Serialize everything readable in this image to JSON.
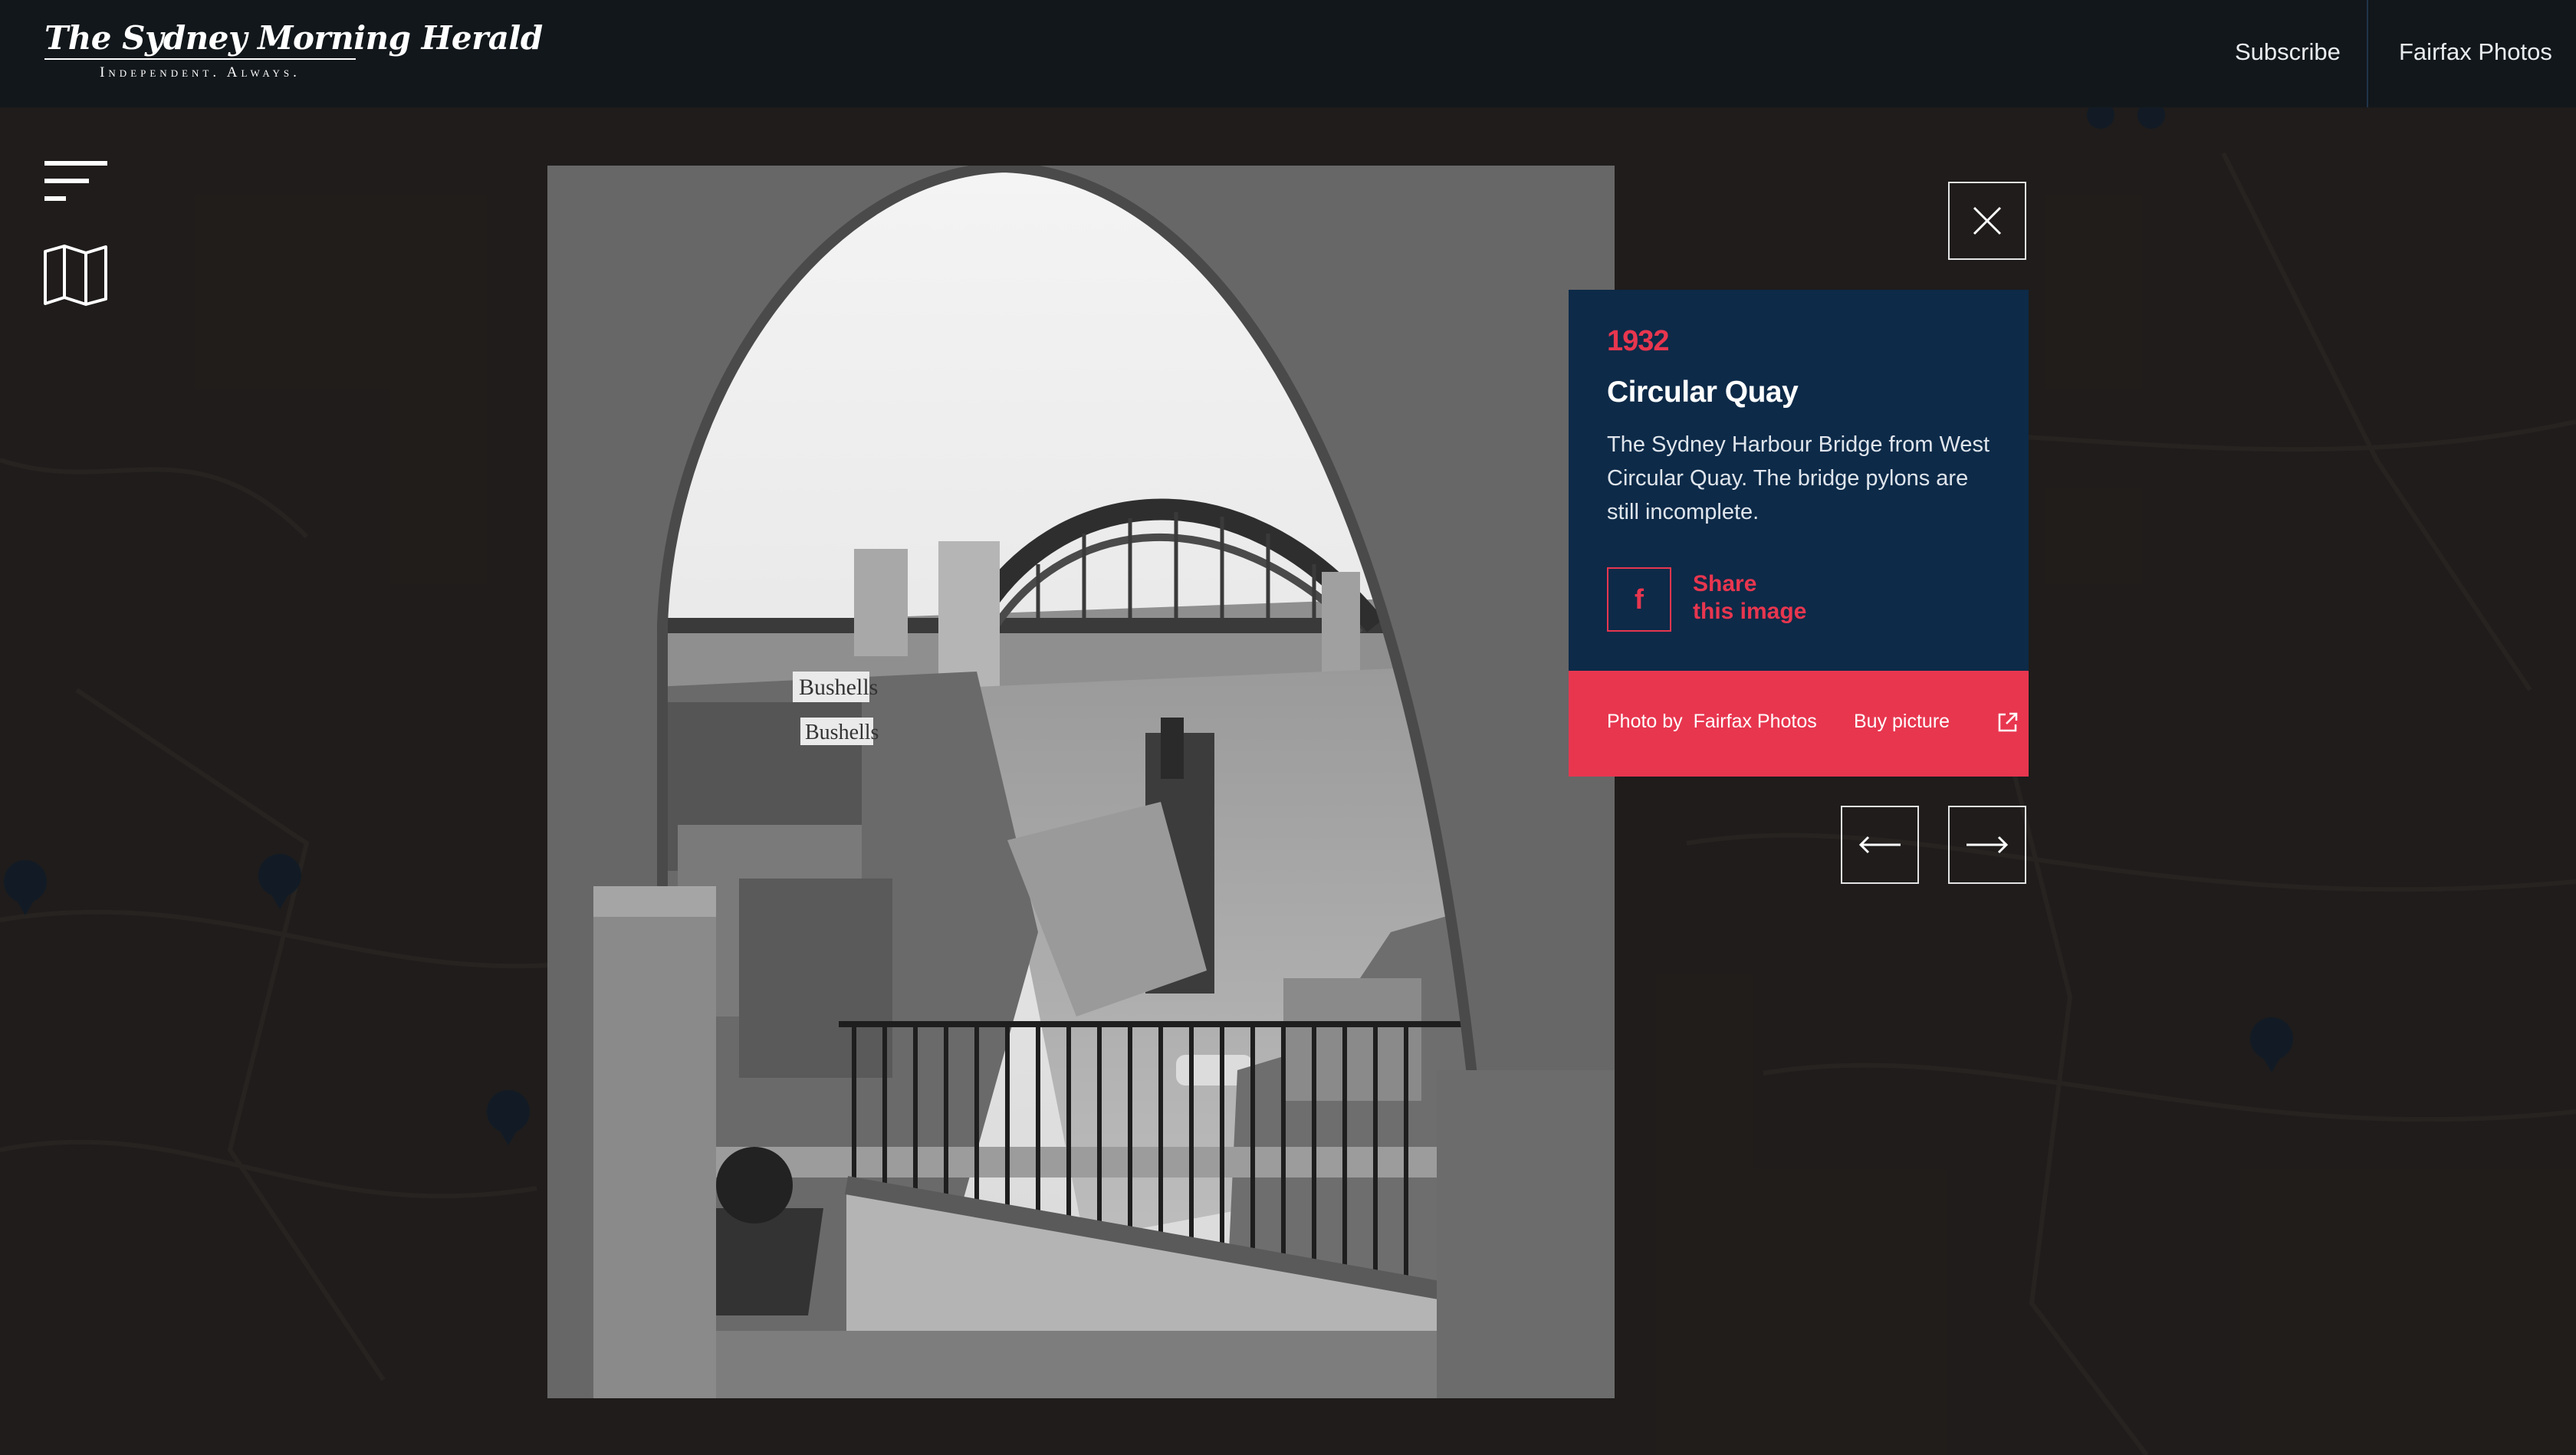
{
  "header": {
    "logo_title": "The Sydney Morning Herald",
    "logo_tagline": "Independent. Always.",
    "links": [
      "Subscribe",
      "Fairfax Photos"
    ]
  },
  "tools": {
    "menu_icon": "hamburger-menu-icon",
    "map_icon": "folded-map-icon"
  },
  "photo": {
    "description": "Black and white photograph of the Sydney Harbour Bridge viewed through a stone arch, with Bushells signs and wharves in the foreground",
    "signs": [
      "Bushells",
      "Bushells"
    ]
  },
  "close_icon": "close-x-icon",
  "card": {
    "year": "1932",
    "title": "Circular Quay",
    "description": "The Sydney Harbour Bridge from West Circular Quay. The bridge pylons are still incomplete.",
    "facebook_icon": "facebook-icon",
    "share_line1": "Share",
    "share_line2": "this image"
  },
  "credit": {
    "photo_by": "Photo by  Fairfax Photos",
    "buy": "Buy picture",
    "external_icon": "external-link-icon"
  },
  "navigation": {
    "prev_icon": "arrow-left-icon",
    "next_icon": "arrow-right-icon"
  },
  "colors": {
    "header_bg": "#12171b",
    "card_bg": "#0d2a48",
    "accent": "#e8364f"
  }
}
